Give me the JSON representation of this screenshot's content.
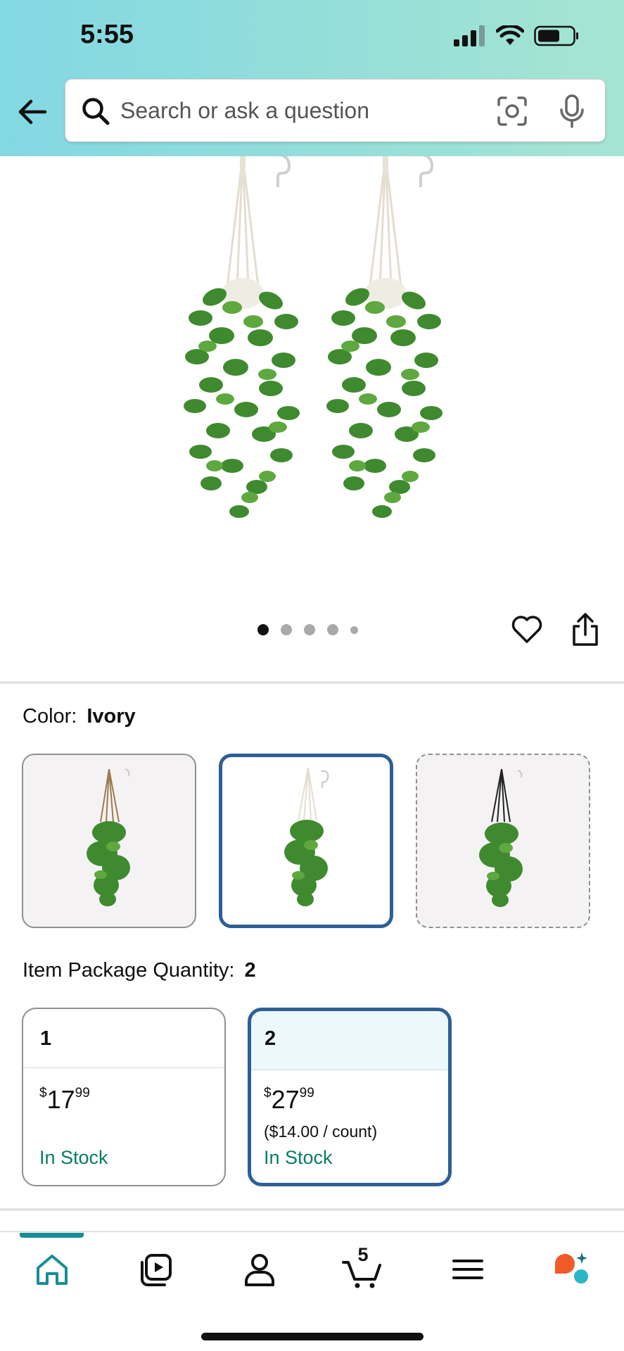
{
  "status_bar": {
    "time": "5:55"
  },
  "search": {
    "placeholder": "Search or ask a question"
  },
  "gallery": {
    "image_count": 5,
    "active_index": 0
  },
  "color": {
    "label": "Color:",
    "selected": "Ivory",
    "options": [
      "tan",
      "ivory",
      "black"
    ]
  },
  "quantity": {
    "label": "Item Package Quantity:",
    "selected": "2",
    "options": [
      {
        "qty": "1",
        "currency": "$",
        "price_whole": "17",
        "price_fraction": "99",
        "per_count": "",
        "stock": "In Stock"
      },
      {
        "qty": "2",
        "currency": "$",
        "price_whole": "27",
        "price_fraction": "99",
        "per_count": "($14.00 / count)",
        "stock": "In Stock"
      }
    ]
  },
  "bottom_nav": {
    "items": [
      "home-icon",
      "video-icon",
      "account-icon",
      "cart-icon",
      "menu-icon",
      "rufus-icon"
    ],
    "cart_count": "5",
    "active": "home"
  },
  "colors": {
    "accent": "#2d5f95",
    "stock_green": "#067d62",
    "nav_active": "#178d97"
  }
}
